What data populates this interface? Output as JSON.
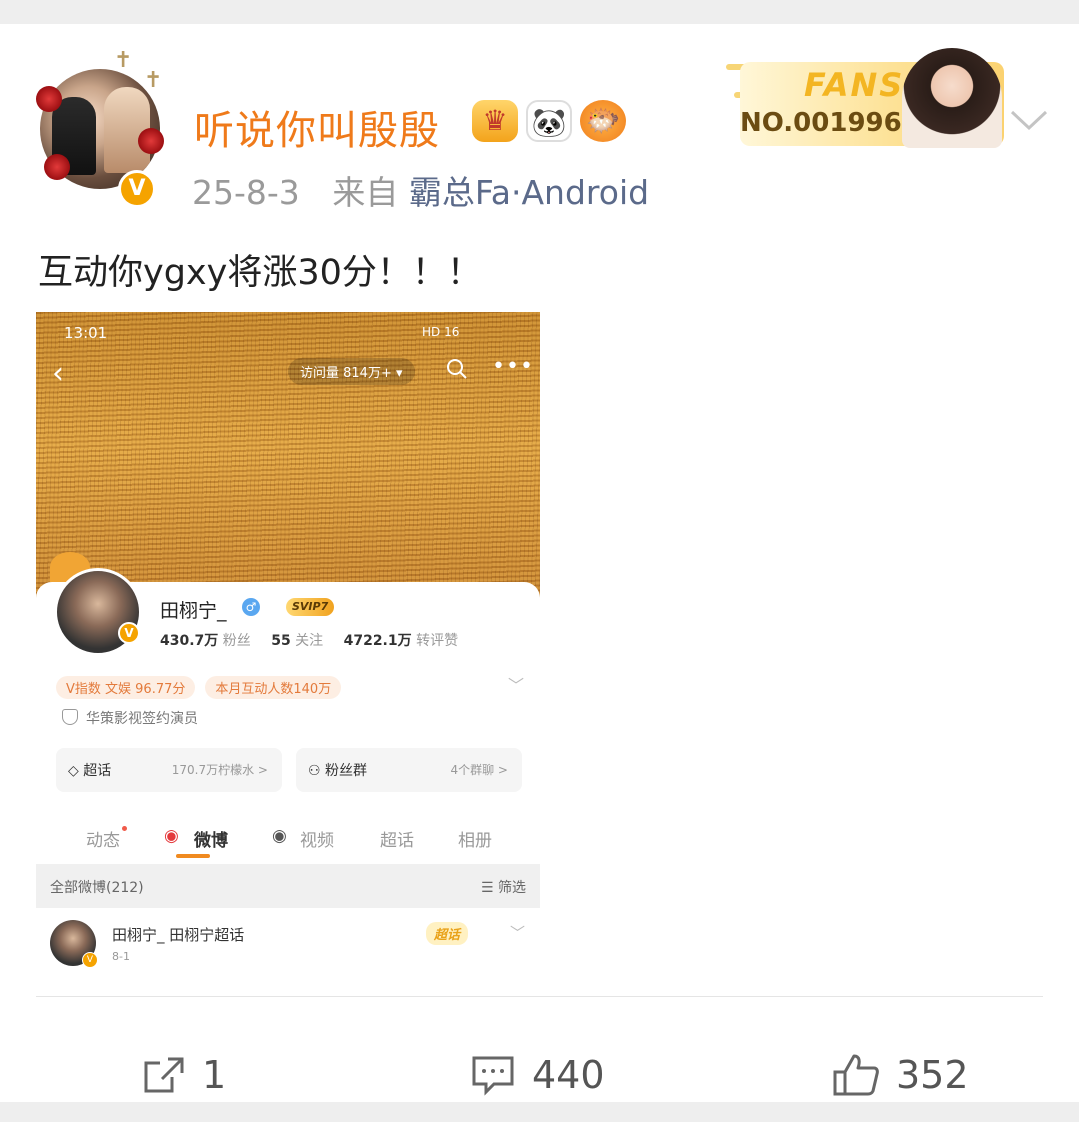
{
  "post": {
    "username": "听说你叫殷殷",
    "date": "25-8-3",
    "from_label": "来自",
    "source": "霸总Fa·Android",
    "text": "互动你ygxy将涨30分！！！"
  },
  "fans_card": {
    "title": "FANS",
    "number": "NO.0019962"
  },
  "badges": [
    "crown-icon",
    "panda-icon",
    "fish-icon"
  ],
  "embedded_screenshot": {
    "status_time": "13:01",
    "status_right": "HD 16",
    "visits": "访问量 814万+ ▾",
    "profile": {
      "name": "田栩宁_",
      "svip": "SVIP7",
      "followers_count": "430.7万",
      "followers_label": "粉丝",
      "following_count": "55",
      "following_label": "关注",
      "interactions_count": "4722.1万",
      "interactions_label": "转评赞",
      "tag1": "V指数 文娱 96.77分",
      "tag2": "本月互动人数140万",
      "certification": "华策影视签约演员",
      "super_topic_label": "超话",
      "super_topic_value": "170.7万柠檬水 >",
      "fan_group_label": "粉丝群",
      "fan_group_value": "4个群聊 >"
    },
    "tabs": [
      "动态",
      "微博",
      "视频",
      "超话",
      "相册"
    ],
    "filter_left": "全部微博(212)",
    "filter_right": "筛选",
    "post_author": "田栩宁_ 田栩宁超话",
    "post_date": "8-1",
    "post_tag": "超话"
  },
  "actions": {
    "repost_count": "1",
    "comment_count": "440",
    "like_count": "352"
  },
  "colors": {
    "username": "#ef7a1a",
    "accent_gold": "#f5a300"
  }
}
